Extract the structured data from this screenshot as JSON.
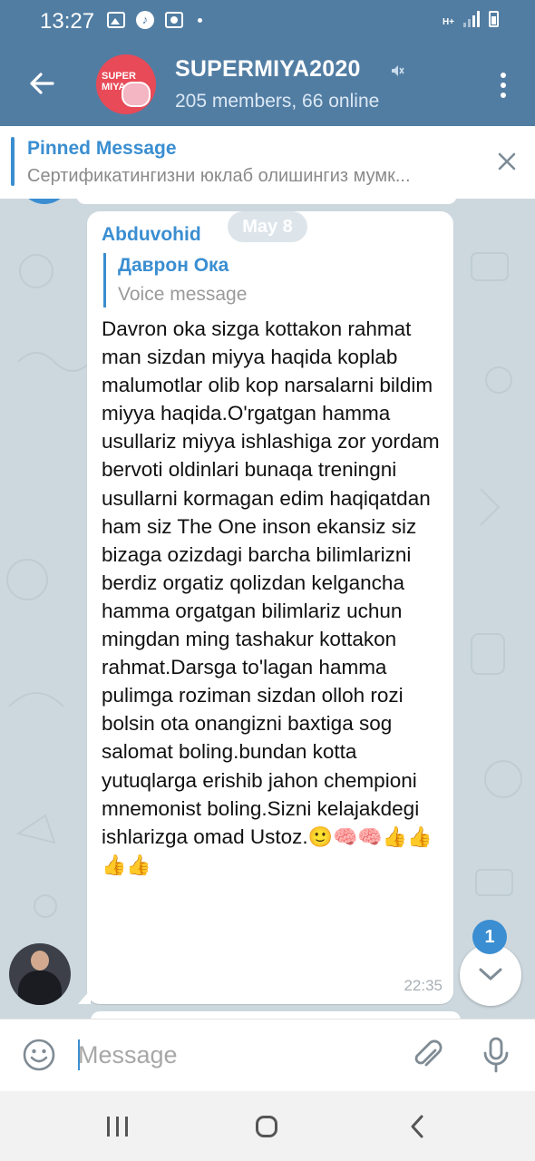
{
  "status_bar": {
    "time": "13:27",
    "network": "H+"
  },
  "header": {
    "title": "SUPERMIYA2020",
    "subtitle": "205 members, 66 online",
    "avatar_text": "SUPER MIYA"
  },
  "pinned": {
    "title": "Pinned Message",
    "text": "Сертификатингизни юклаб олишингиз мумк..."
  },
  "chat": {
    "date_chip": "May 8",
    "message": {
      "sender": "Abduvohid",
      "reply_to": {
        "name": "Даврон Ока",
        "text": "Voice message"
      },
      "text": "Davron oka sizga kottakon rahmat man sizdan miyya haqida koplab malumotlar olib kop narsalarni bildim miyya haqida.O'rgatgan hamma usullariz miyya ishlashiga zor yordam bervoti oldinlari bunaqa treningni usullarni kormagan edim haqiqatdan ham siz The One inson ekansiz siz bizaga ozizdagi barcha bilimlarizni berdiz orgatiz qolizdan kelgancha hamma orgatgan bilimlariz uchun mingdan ming tashakur kottakon rahmat.Darsga to'lagan hamma pulimga roziman sizdan olloh rozi bolsin ota onangizni baxtiga sog salomat boling.bundan kotta yutuqlarga erishib jahon chempioni mnemonist boling.Sizni kelajakdegi ishlarizga omad Ustoz.",
      "emoji_tail": "🙂🧠🧠👍👍👍👍",
      "time": "22:35"
    },
    "unread_badge": "1"
  },
  "input": {
    "placeholder": "Message"
  },
  "colors": {
    "header": "#527da3",
    "accent": "#3a8ed1",
    "status_bar": "#517da2"
  }
}
